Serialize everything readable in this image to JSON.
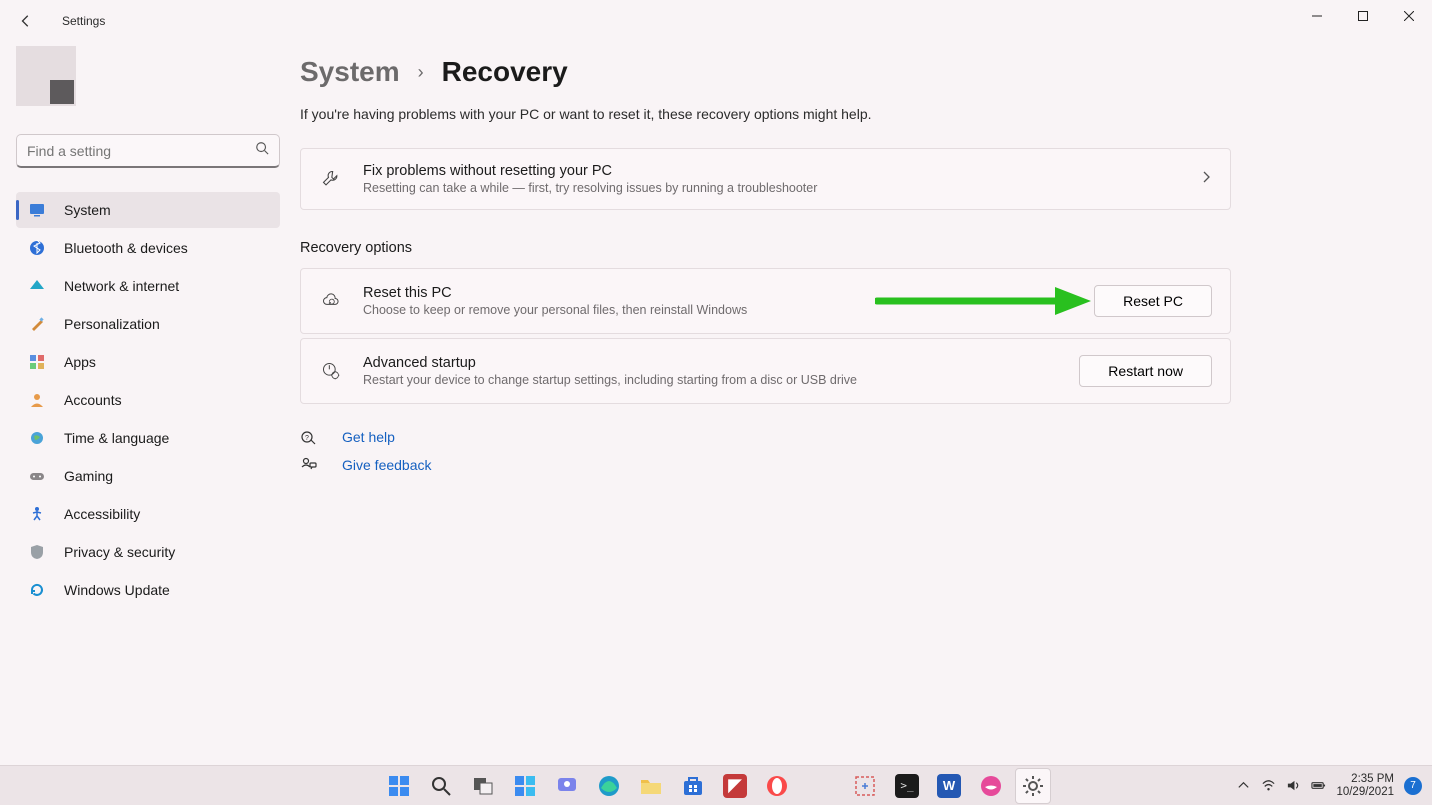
{
  "app": {
    "title": "Settings"
  },
  "search": {
    "placeholder": "Find a setting"
  },
  "sidebar": {
    "items": [
      {
        "label": "System"
      },
      {
        "label": "Bluetooth & devices"
      },
      {
        "label": "Network & internet"
      },
      {
        "label": "Personalization"
      },
      {
        "label": "Apps"
      },
      {
        "label": "Accounts"
      },
      {
        "label": "Time & language"
      },
      {
        "label": "Gaming"
      },
      {
        "label": "Accessibility"
      },
      {
        "label": "Privacy & security"
      },
      {
        "label": "Windows Update"
      }
    ]
  },
  "breadcrumb": {
    "parent": "System",
    "current": "Recovery"
  },
  "page": {
    "description": "If you're having problems with your PC or want to reset it, these recovery options might help.",
    "troubleshoot": {
      "title": "Fix problems without resetting your PC",
      "subtitle": "Resetting can take a while — first, try resolving issues by running a troubleshooter"
    },
    "section_heading": "Recovery options",
    "reset": {
      "title": "Reset this PC",
      "subtitle": "Choose to keep or remove your personal files, then reinstall Windows",
      "button": "Reset PC"
    },
    "advanced": {
      "title": "Advanced startup",
      "subtitle": "Restart your device to change startup settings, including starting from a disc or USB drive",
      "button": "Restart now"
    },
    "help_links": {
      "get_help": "Get help",
      "feedback": "Give feedback"
    }
  },
  "taskbar": {
    "time": "2:35 PM",
    "date": "10/29/2021",
    "notif_count": "7"
  }
}
